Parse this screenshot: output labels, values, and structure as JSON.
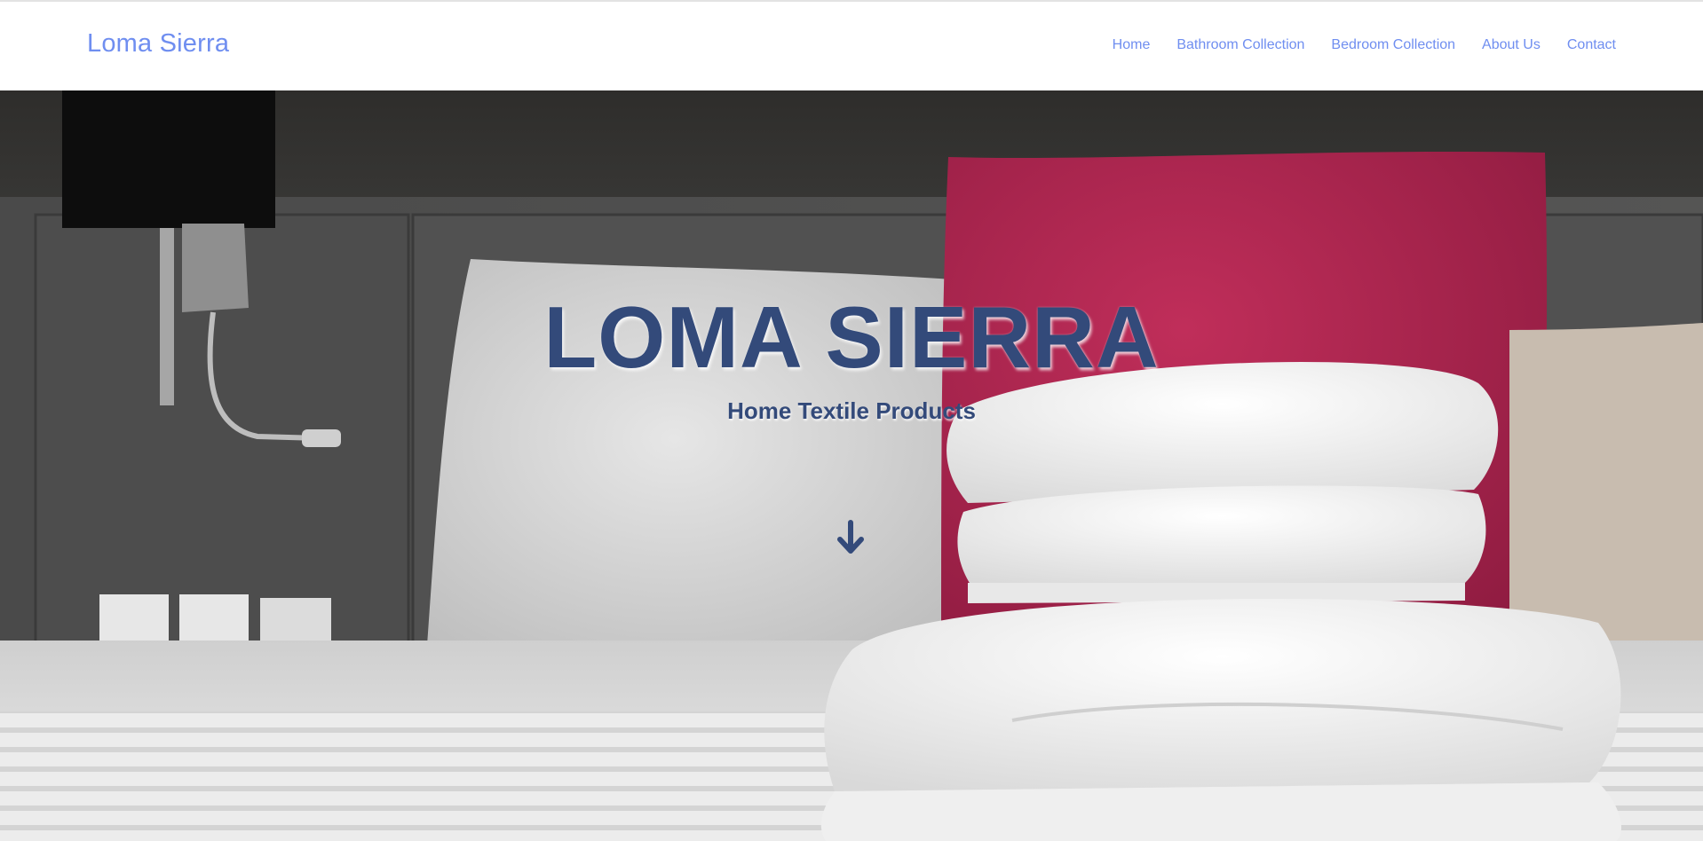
{
  "header": {
    "brand": "Loma Sierra",
    "nav": [
      {
        "label": "Home"
      },
      {
        "label": "Bathroom Collection"
      },
      {
        "label": "Bedroom Collection"
      },
      {
        "label": "About Us"
      },
      {
        "label": "Contact"
      }
    ]
  },
  "hero": {
    "title": "LOMA SIERRA",
    "subtitle": "Home Textile Products",
    "scroll_icon": "arrow-down-icon",
    "background_image": "bedroom with white pillows, red cushion and stacked white towels"
  },
  "colors": {
    "brand": "#6f8ef0",
    "hero_text": "#334a7a"
  }
}
